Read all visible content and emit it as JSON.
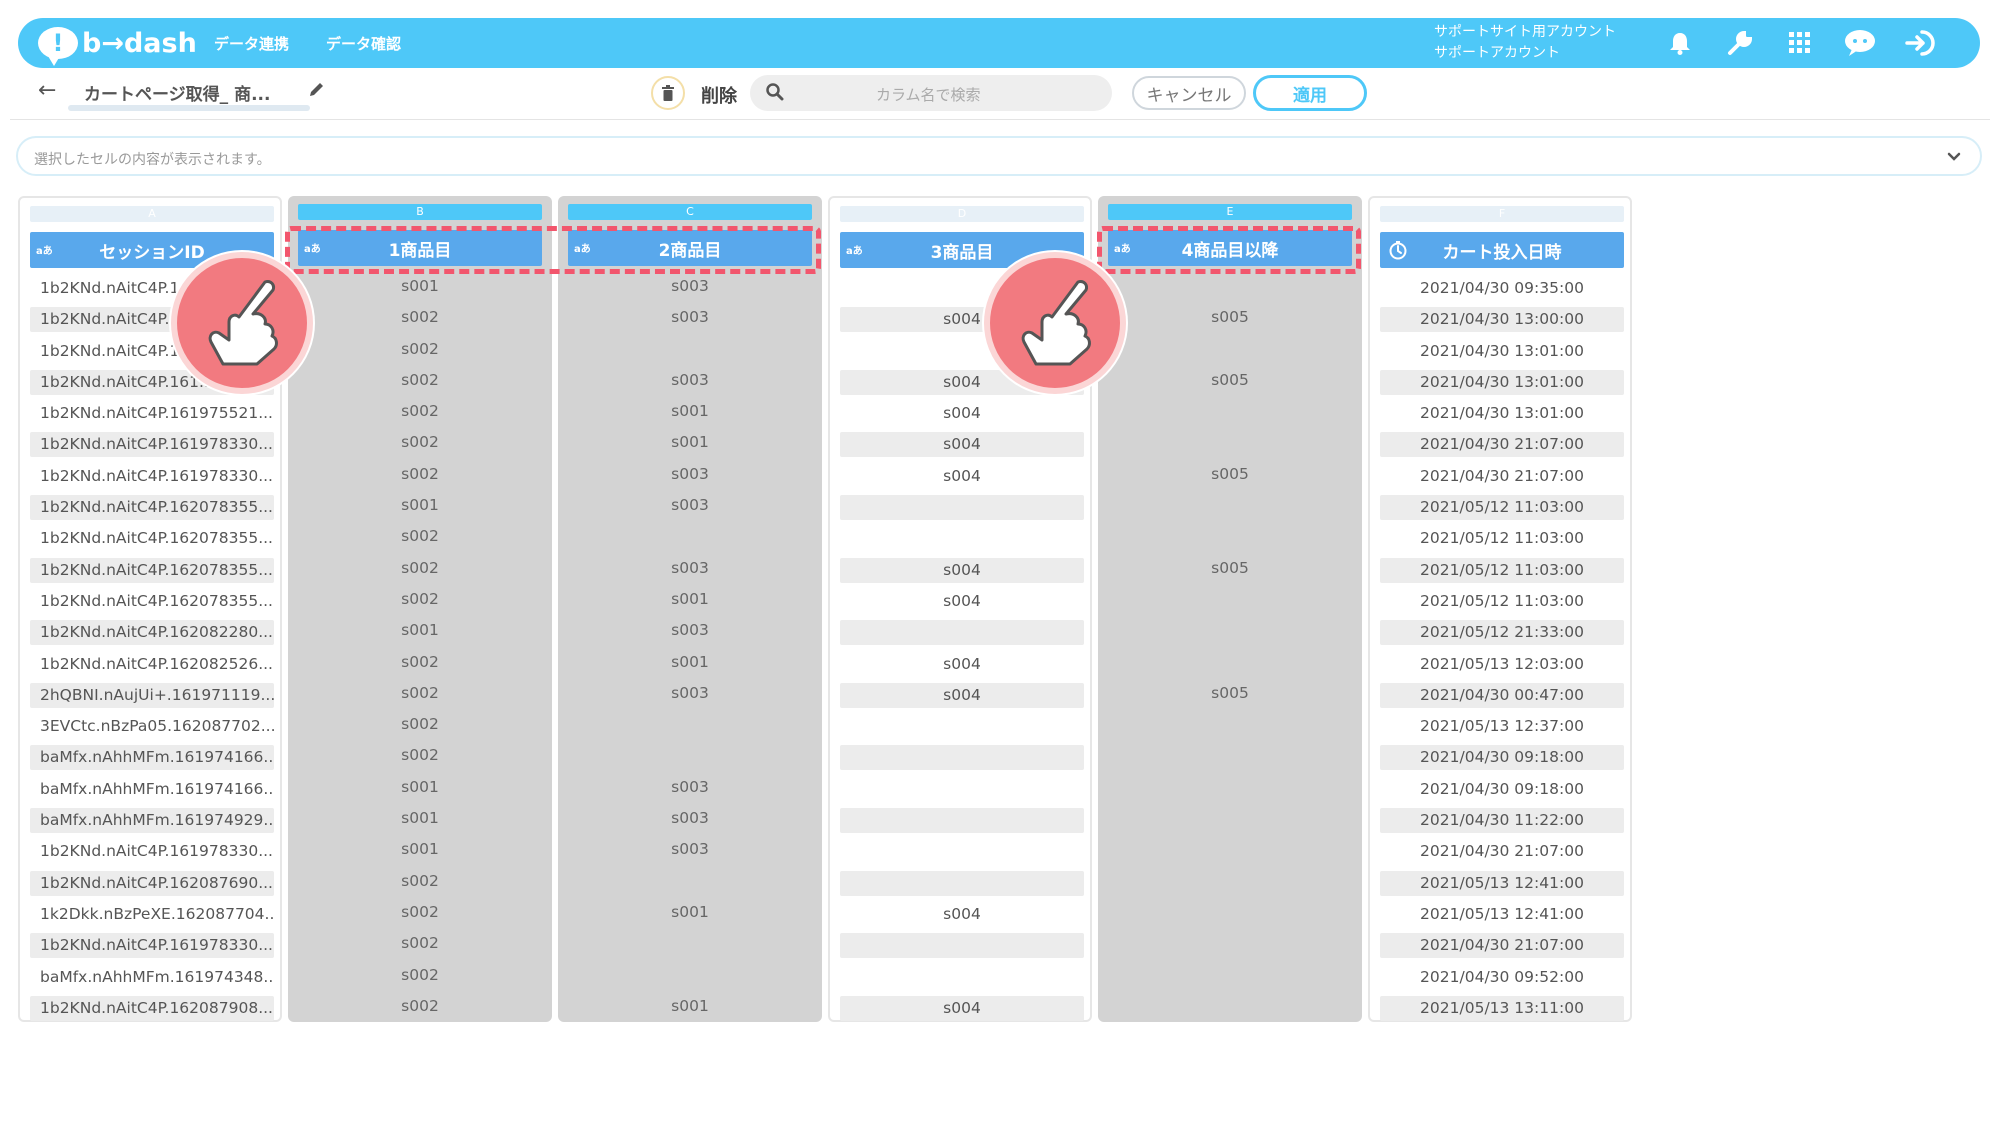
{
  "header": {
    "logo": "b→dash",
    "logo_mark": "!",
    "nav": [
      "データ連携",
      "データ確認"
    ],
    "account_line1": "サポートサイト用アカウント",
    "account_line2": "サポートアカウント",
    "icons": [
      "bell-icon",
      "wrench-icon",
      "grid-icon",
      "chat-icon",
      "logout-icon"
    ],
    "accent": "#4ec8f8"
  },
  "toolbar": {
    "tab_name": "カートページ取得_ 商...",
    "delete_label": "削除",
    "search_placeholder": "カラム名で検索",
    "cancel_label": "キャンセル",
    "apply_label": "適用"
  },
  "cell_bar": {
    "placeholder": "選択したセルの内容が表示されます。"
  },
  "columns": [
    {
      "letter": "A",
      "header": "セッションID",
      "type_badge": "aあ",
      "selected": false,
      "cells": [
        "1b2KNd.nAitC4P.16...",
        "1b2KNd.nAitC4P.1...",
        "1b2KNd.nAitC4P.1...",
        "1b2KNd.nAitC4P.161...",
        "1b2KNd.nAitC4P.161975521...",
        "1b2KNd.nAitC4P.161978330...",
        "1b2KNd.nAitC4P.161978330...",
        "1b2KNd.nAitC4P.162078355...",
        "1b2KNd.nAitC4P.162078355...",
        "1b2KNd.nAitC4P.162078355...",
        "1b2KNd.nAitC4P.162078355...",
        "1b2KNd.nAitC4P.162082280...",
        "1b2KNd.nAitC4P.162082526...",
        "2hQBNI.nAujUi+.161971119...",
        "3EVCtc.nBzPa05.162087702...",
        "baMfx.nAhhMFm.161974166...",
        "baMfx.nAhhMFm.161974166...",
        "baMfx.nAhhMFm.161974929...",
        "1b2KNd.nAitC4P.161978330...",
        "1b2KNd.nAitC4P.162087690...",
        "1k2Dkk.nBzPeXE.162087704...",
        "1b2KNd.nAitC4P.161978330...",
        "baMfx.nAhhMFm.161974348...",
        "1b2KNd.nAitC4P.162087908..."
      ]
    },
    {
      "letter": "B",
      "header": "1商品目",
      "type_badge": "aあ",
      "selected": true,
      "cells": [
        "s001",
        "s002",
        "s002",
        "s002",
        "s002",
        "s002",
        "s002",
        "s001",
        "s002",
        "s002",
        "s002",
        "s001",
        "s002",
        "s002",
        "s002",
        "s002",
        "s001",
        "s001",
        "s001",
        "s002",
        "s002",
        "s002",
        "s002",
        "s002"
      ]
    },
    {
      "letter": "C",
      "header": "2商品目",
      "type_badge": "aあ",
      "selected": true,
      "cells": [
        "s003",
        "s003",
        "",
        "s003",
        "s001",
        "s001",
        "s003",
        "s003",
        "",
        "s003",
        "s001",
        "s003",
        "s001",
        "s003",
        "",
        "",
        "s003",
        "s003",
        "s003",
        "",
        "s001",
        "",
        "",
        "s001"
      ]
    },
    {
      "letter": "D",
      "header": "3商品目",
      "type_badge": "aあ",
      "selected": false,
      "cells": [
        "",
        "s004",
        "",
        "s004",
        "s004",
        "s004",
        "s004",
        "",
        "",
        "s004",
        "s004",
        "",
        "s004",
        "s004",
        "",
        "",
        "",
        "",
        "",
        "",
        "s004",
        "",
        "",
        "s004"
      ]
    },
    {
      "letter": "E",
      "header": "4商品目以降",
      "type_badge": "aあ",
      "selected": true,
      "cells": [
        "",
        "s005",
        "",
        "s005",
        "",
        "",
        "s005",
        "",
        "",
        "s005",
        "",
        "",
        "",
        "s005",
        "",
        "",
        "",
        "",
        "",
        "",
        "",
        "",
        "",
        ""
      ]
    },
    {
      "letter": "F",
      "header": "カート投入日時",
      "type_badge": "clock-icon",
      "selected": false,
      "cells": [
        "2021/04/30 09:35:00",
        "2021/04/30 13:00:00",
        "2021/04/30 13:01:00",
        "2021/04/30 13:01:00",
        "2021/04/30 13:01:00",
        "2021/04/30 21:07:00",
        "2021/04/30 21:07:00",
        "2021/05/12 11:03:00",
        "2021/05/12 11:03:00",
        "2021/05/12 11:03:00",
        "2021/05/12 11:03:00",
        "2021/05/12 21:33:00",
        "2021/05/13 12:03:00",
        "2021/04/30 00:47:00",
        "2021/05/13 12:37:00",
        "2021/04/30 09:18:00",
        "2021/04/30 09:18:00",
        "2021/04/30 11:22:00",
        "2021/04/30 21:07:00",
        "2021/05/13 12:41:00",
        "2021/05/13 12:41:00",
        "2021/04/30 21:07:00",
        "2021/04/30 09:52:00",
        "2021/05/13 13:11:00"
      ]
    }
  ],
  "colors": {
    "header_blue": "#59a8ec",
    "selected_gray": "#d3d3d3",
    "highlight_red": "#f2566d",
    "pointer_pink": "#f27a80"
  }
}
